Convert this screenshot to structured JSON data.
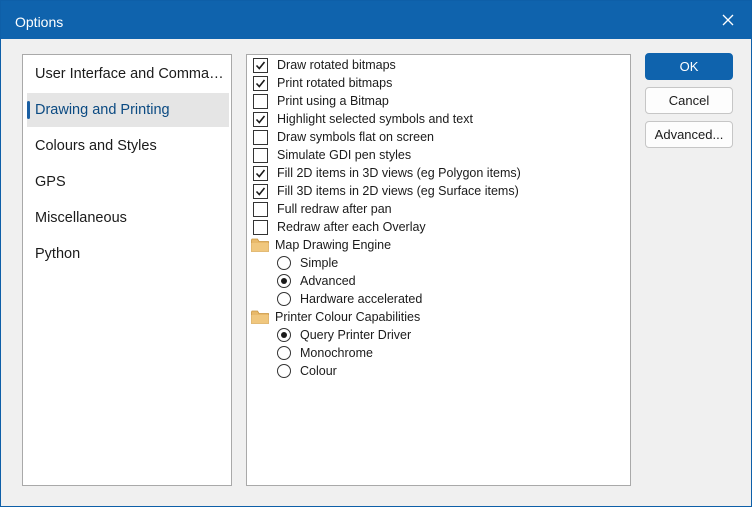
{
  "window": {
    "title": "Options",
    "close_icon": "close-icon"
  },
  "sidebar": {
    "items": [
      {
        "label": "User Interface and Commands"
      },
      {
        "label": "Drawing and Printing",
        "selected": true
      },
      {
        "label": "Colours and Styles"
      },
      {
        "label": "GPS"
      },
      {
        "label": "Miscellaneous"
      },
      {
        "label": "Python"
      }
    ]
  },
  "options": {
    "checkboxes": [
      {
        "label": "Draw rotated bitmaps",
        "checked": true
      },
      {
        "label": "Print rotated bitmaps",
        "checked": true
      },
      {
        "label": "Print using a Bitmap",
        "checked": false
      },
      {
        "label": "Highlight selected symbols and text",
        "checked": true
      },
      {
        "label": "Draw symbols flat on screen",
        "checked": false
      },
      {
        "label": "Simulate GDI pen styles",
        "checked": false
      },
      {
        "label": "Fill 2D items in 3D views (eg Polygon items)",
        "checked": true
      },
      {
        "label": "Fill 3D items in 2D views (eg Surface items)",
        "checked": true
      },
      {
        "label": "Full redraw after pan",
        "checked": false
      },
      {
        "label": "Redraw after each Overlay",
        "checked": false
      }
    ],
    "groups": [
      {
        "label": "Map Drawing Engine",
        "icon": "folder-icon",
        "options": [
          {
            "label": "Simple",
            "selected": false
          },
          {
            "label": "Advanced",
            "selected": true
          },
          {
            "label": "Hardware accelerated",
            "selected": false
          }
        ]
      },
      {
        "label": "Printer Colour Capabilities",
        "icon": "folder-icon",
        "options": [
          {
            "label": "Query Printer Driver",
            "selected": true
          },
          {
            "label": "Monochrome",
            "selected": false
          },
          {
            "label": "Colour",
            "selected": false
          }
        ]
      }
    ]
  },
  "buttons": {
    "ok": "OK",
    "cancel": "Cancel",
    "advanced": "Advanced..."
  },
  "colors": {
    "accent": "#0f63ad",
    "selected_item_bg": "#e5e5e5",
    "folder": "#e8b96a"
  }
}
